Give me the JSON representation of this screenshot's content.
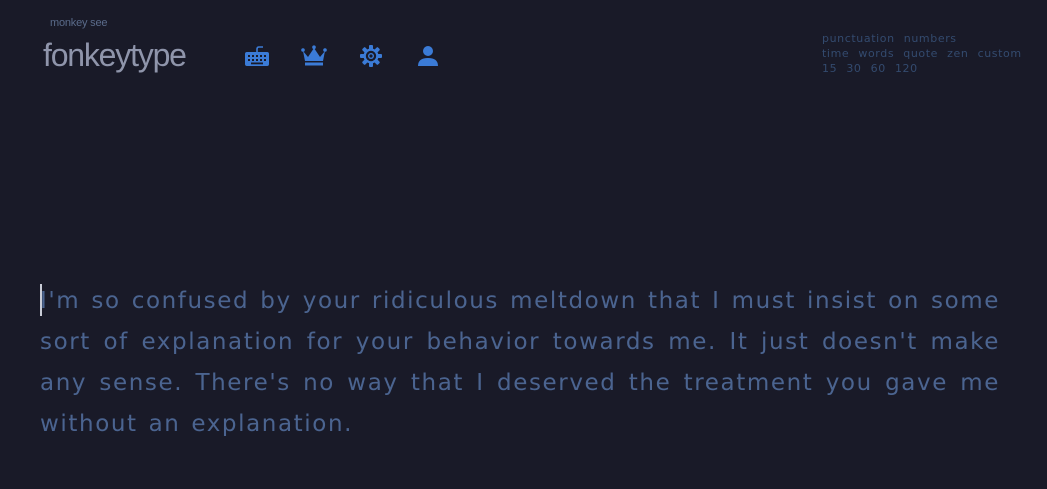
{
  "header": {
    "tagline": "monkey see",
    "logo": "fonkeytype",
    "nav": [
      {
        "icon": "keyboard-icon",
        "name": "keyboard"
      },
      {
        "icon": "crown-icon",
        "name": "leaderboards"
      },
      {
        "icon": "gear-icon",
        "name": "settings"
      },
      {
        "icon": "user-icon",
        "name": "account"
      }
    ],
    "accent_color": "#3b7bd6"
  },
  "config": {
    "row1": [
      "punctuation",
      "numbers"
    ],
    "row2": [
      "time",
      "words",
      "quote",
      "zen",
      "custom"
    ],
    "row3": [
      "15",
      "30",
      "60",
      "120"
    ]
  },
  "test": {
    "text": "I'm so confused by your ridiculous meltdown that I must insist on some sort of explanation for your behavior towards me. It just doesn't make any sense. There's no way that I deserved the treatment you gave me without an explanation."
  },
  "colors": {
    "background": "#191a28",
    "text": "#4b6490",
    "caret": "#c8cbd6"
  }
}
